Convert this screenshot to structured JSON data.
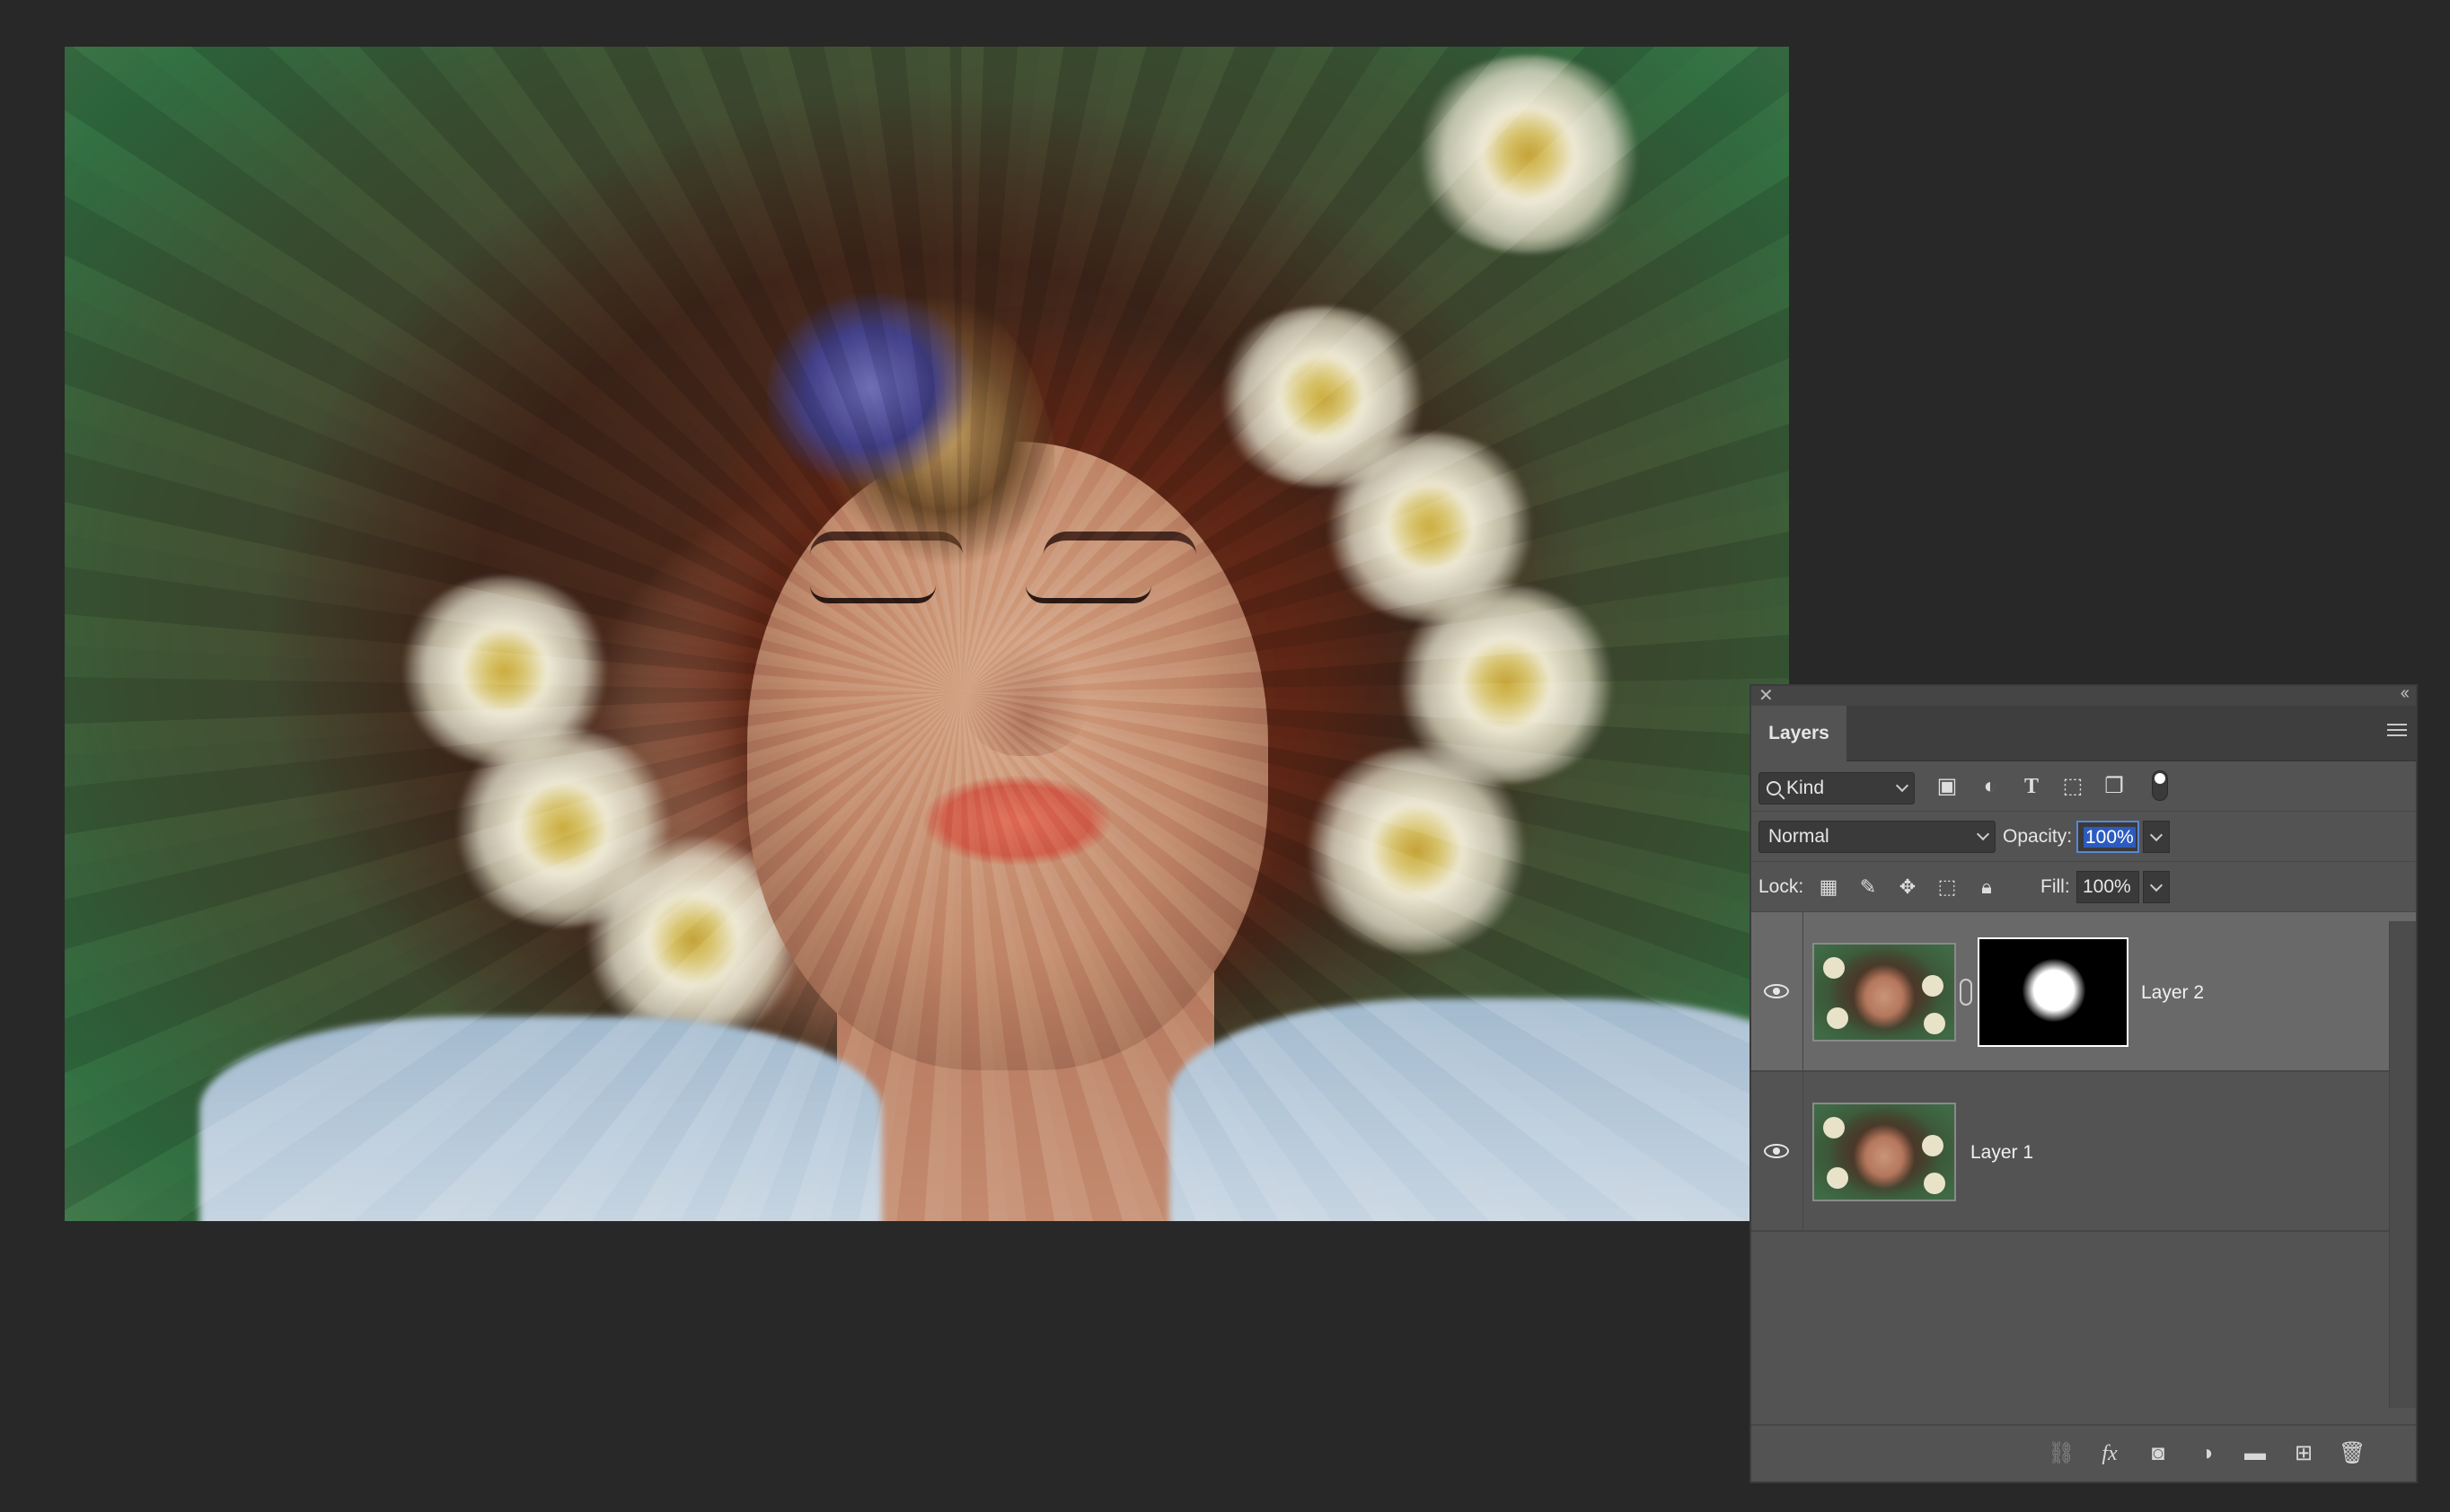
{
  "canvas": {
    "image_alt": "Photo: woman lying among white flowers with radial zoom blur, butterfly on forehead"
  },
  "layers_panel": {
    "tab_label": "Layers",
    "filter": {
      "kind_label": "Kind",
      "icons": [
        "image-filter-icon",
        "adjustment-filter-icon",
        "type-filter-icon",
        "shape-filter-icon",
        "smart-object-filter-icon"
      ]
    },
    "blend_mode": "Normal",
    "opacity_label": "Opacity:",
    "opacity_value": "100%",
    "lock_label": "Lock:",
    "fill_label": "Fill:",
    "fill_value": "100%",
    "layers": [
      {
        "name": "Layer 2",
        "visible": true,
        "has_mask": true,
        "selected": true
      },
      {
        "name": "Layer 1",
        "visible": true,
        "has_mask": false,
        "selected": false
      }
    ],
    "bottom_icons": [
      "link-layers-icon",
      "fx-icon",
      "add-mask-icon",
      "adjustment-layer-icon",
      "new-group-icon",
      "new-layer-icon",
      "delete-layer-icon"
    ],
    "fx_label": "fx"
  },
  "colors": {
    "app_background": "#282828",
    "panel_background": "#535353",
    "selected_row": "#696969",
    "focus_accent": "#2c5bc0"
  }
}
